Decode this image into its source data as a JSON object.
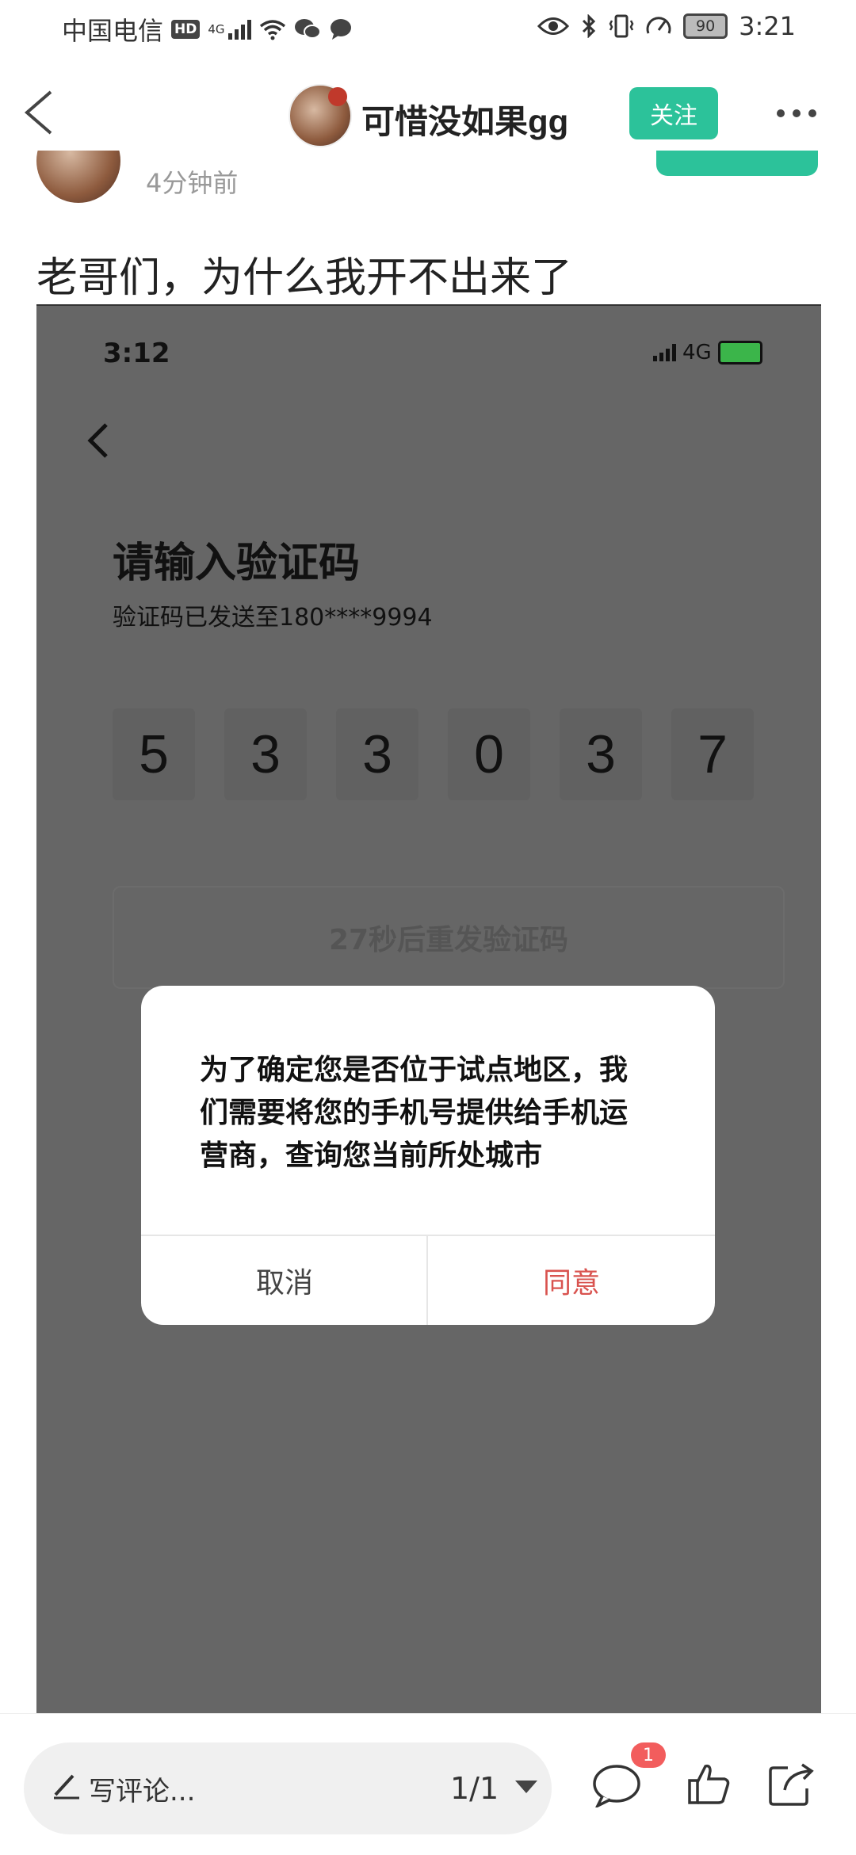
{
  "status_bar": {
    "carrier": "中国电信",
    "hd": "HD",
    "signal_type": "4G",
    "battery": "90",
    "time": "3:21"
  },
  "header": {
    "username": "可惜没如果gg",
    "follow_label": "关注"
  },
  "author_row": {
    "time_ago": "4分钟前"
  },
  "post": {
    "title": "老哥们，为什么我开不出来了"
  },
  "post_image": {
    "time": "3:12",
    "network": "4G",
    "heading": "请输入验证码",
    "subtitle": "验证码已发送至180****9994",
    "digits": [
      "5",
      "3",
      "3",
      "0",
      "3",
      "7"
    ],
    "resend": "27秒后重发验证码",
    "dialog": {
      "message": "为了确定您是否位于试点地区，我们需要将您的手机号提供给手机运营商，查询您当前所处城市",
      "cancel_label": "取消",
      "agree_label": "同意"
    }
  },
  "bottom_bar": {
    "comment_placeholder": "写评论...",
    "page_indicator": "1/1",
    "comment_badge": "1"
  },
  "colors": {
    "accent": "#2cc29a",
    "overlay": "#666666",
    "agree": "#d9534f",
    "badge": "#f25d5d"
  }
}
